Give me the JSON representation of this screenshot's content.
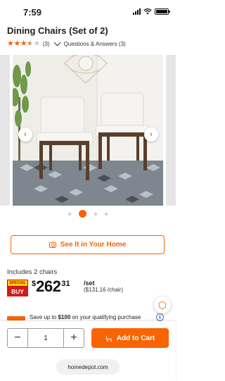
{
  "status_bar": {
    "time": "7:59"
  },
  "product": {
    "title": "Dining Chairs (Set of 2)",
    "rating": 3.5,
    "review_count": "(3)",
    "qa_label": "Questions & Answers (3)"
  },
  "carousel": {
    "dot_count": 4,
    "active_index": 1
  },
  "see_in_home_label": "See It in Your Home",
  "pricing": {
    "includes": "Includes 2 chairs",
    "badge_top": "SPECIAL",
    "badge_bottom": "BUY",
    "currency": "$",
    "dollars": "262",
    "cents": "31",
    "per_set": "/set",
    "per_chair": "($131.16 /chair)"
  },
  "promo": {
    "lead": "Save up to ",
    "amount": "$100",
    "tail": " on your qualifying purchase"
  },
  "cart": {
    "quantity": "1",
    "minus": "−",
    "plus": "+",
    "add_label": "Add to Cart"
  },
  "browser": {
    "url": "homedepot.com"
  },
  "colors": {
    "accent": "#f96302",
    "star_empty": "#c8c8c8",
    "badge_red": "#d21c1c",
    "badge_yellow": "#ffd700"
  }
}
